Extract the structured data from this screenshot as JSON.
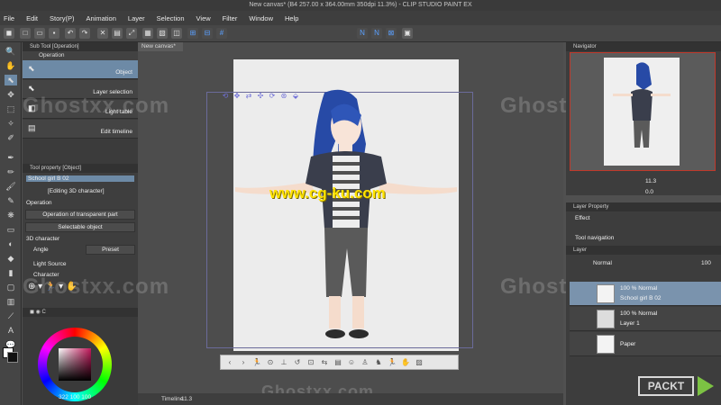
{
  "window": {
    "title": "New canvas* (B4 257.00 x 364.00mm 350dpi 11.3%) - CLIP STUDIO PAINT EX"
  },
  "menu": [
    "File",
    "Edit",
    "Story(P)",
    "Animation",
    "Layer",
    "Selection",
    "View",
    "Filter",
    "Window",
    "Help"
  ],
  "subtool": {
    "header": "Sub Tool [Operation]",
    "tab": "Operation",
    "items": [
      "Object",
      "Layer selection",
      "Light table",
      "Edit timeline"
    ]
  },
  "toolprop": {
    "header": "Tool property [Object]",
    "object_name": "School girl B 02",
    "editing": "[Editing 3D character]",
    "operation_label": "Operation",
    "operation_value": "Operation of transparent part",
    "selectable": "Selectable object",
    "section_3d": "3D character",
    "angle_label": "Angle",
    "preset_label": "Preset",
    "light_source": "Light Source",
    "character_label": "Character"
  },
  "color": {
    "readout": "322  100  100"
  },
  "canvas": {
    "tab": "New canvas*",
    "zoom": "11.3",
    "timeline_label": "Timeline"
  },
  "navigator": {
    "header": "Navigator",
    "zoom": "11.3",
    "angle": "0.0"
  },
  "layerprop": {
    "header": "Layer Property",
    "effect": "Effect",
    "tool_navigation": "Tool navigation"
  },
  "layers": {
    "header": "Layer",
    "blend": "Normal",
    "opacity": "100",
    "rows": [
      {
        "percent": "100 %  Normal",
        "name": "School girl B 02"
      },
      {
        "percent": "100 %  Normal",
        "name": "Layer 1"
      },
      {
        "percent": "",
        "name": "Paper"
      }
    ]
  },
  "watermark": {
    "text": "www.cg-ku.com",
    "ghost": "Ghostxx.com"
  },
  "brand": {
    "name": "PACKT"
  }
}
